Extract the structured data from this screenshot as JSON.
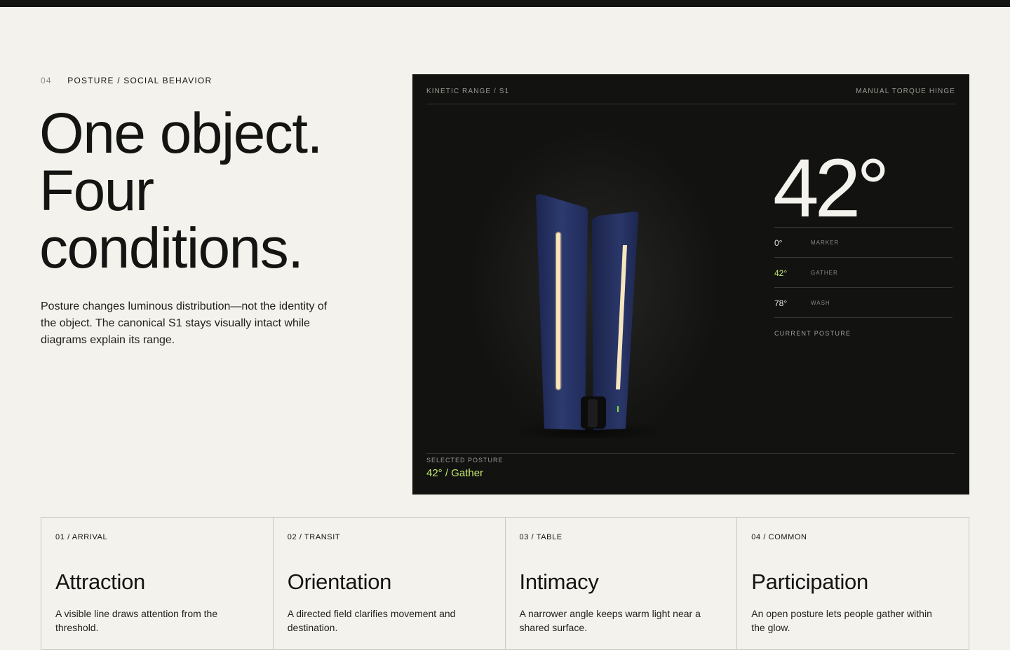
{
  "section": {
    "number": "04",
    "label": "POSTURE / SOCIAL BEHAVIOR"
  },
  "headline": {
    "line1": "One object.",
    "line2": "Four",
    "line3": "conditions."
  },
  "intro": "Posture changes luminous distribution—not the identity of the object. The canonical S1 stays visually intact while diagrams explain its range.",
  "panel": {
    "head_left": "KINETIC RANGE / S1",
    "head_right": "MANUAL TORQUE HINGE",
    "big_angle": "42°",
    "scale": [
      {
        "deg": "0°",
        "name": "MARKER",
        "active": false
      },
      {
        "deg": "42°",
        "name": "GATHER",
        "active": true
      },
      {
        "deg": "78°",
        "name": "WASH",
        "active": false
      }
    ],
    "current_label": "CURRENT POSTURE",
    "selected_label": "SELECTED POSTURE",
    "selected_value": "42° / Gather"
  },
  "cards": [
    {
      "cat": "01 / ARRIVAL",
      "title": "Attraction",
      "desc": "A visible line draws attention from the threshold."
    },
    {
      "cat": "02 / TRANSIT",
      "title": "Orientation",
      "desc": "A directed field clarifies movement and destination."
    },
    {
      "cat": "03 / TABLE",
      "title": "Intimacy",
      "desc": "A narrower angle keeps warm light near a shared surface."
    },
    {
      "cat": "04 / COMMON",
      "title": "Participation",
      "desc": "An open posture lets people gather within the glow."
    }
  ],
  "colors": {
    "accent": "#c2e86a",
    "panel": "#121211",
    "background": "#f3f2ec",
    "lamp_body": "#24315f"
  },
  "icons": [
    "lamp-illustration"
  ]
}
